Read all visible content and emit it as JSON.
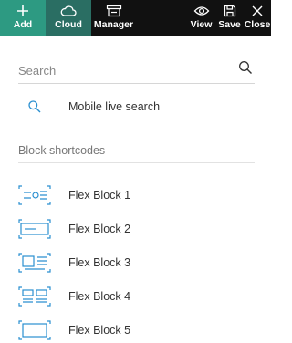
{
  "toolbar": {
    "add_label": "Add",
    "cloud_label": "Cloud",
    "manager_label": "Manager",
    "view_label": "View",
    "save_label": "Save",
    "close_label": "Close"
  },
  "search": {
    "placeholder": "Search",
    "value": ""
  },
  "live_search": {
    "label": "Mobile live search",
    "icon": "search-icon"
  },
  "section": {
    "title": "Block shortcodes"
  },
  "blocks": [
    {
      "label": "Flex Block 1",
      "icon": "flex-block-1-icon"
    },
    {
      "label": "Flex Block 2",
      "icon": "flex-block-2-icon"
    },
    {
      "label": "Flex Block 3",
      "icon": "flex-block-3-icon"
    },
    {
      "label": "Flex Block 4",
      "icon": "flex-block-4-icon"
    },
    {
      "label": "Flex Block 5",
      "icon": "flex-block-5-icon"
    }
  ],
  "colors": {
    "toolbar_bg": "#111111",
    "add_bg": "#2d9a82",
    "cloud_bg": "#2a6e63",
    "accent_blue": "#2a8fd0",
    "text": "#333333",
    "muted": "#777777"
  }
}
